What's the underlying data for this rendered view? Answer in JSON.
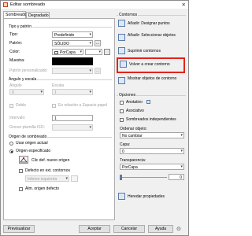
{
  "window": {
    "title": "Editar sombreado"
  },
  "tabs": [
    {
      "label": "Sombreado"
    },
    {
      "label": "Degradado"
    }
  ],
  "tipo_patron": {
    "group_title": "Tipo y patrón",
    "tipo_label": "Tipo:",
    "tipo_value": "Predefinido",
    "patron_label": "Patrón:",
    "patron_value": "SÓLIDO",
    "color_label": "Color:",
    "color_value": "PorCapa",
    "muestra_label": "Muestra:",
    "patron_personalizado_label": "Patrón personalizado:"
  },
  "angulo_escala": {
    "group_title": "Ángulo y escala",
    "angulo_label": "Ángulo",
    "angulo_value": "0",
    "escala_label": "Escala",
    "escala_value": "1",
    "doble_label": "Doble",
    "relacion_label": "En relación a Espacio papel",
    "intervalo_label": "Intervalo:",
    "intervalo_value": "1",
    "grosor_label": "Grosor plumilla ISO:"
  },
  "origen": {
    "group_title": "Origen de sombreado",
    "usar_actual_label": "Usar origen actual",
    "especificado_label": "Origen especificado",
    "clic_label": "Clic def. nuevo origen",
    "defecto_ext_label": "Defecto en ext. contornos",
    "inferior_value": "Inferior izquierda",
    "alm_label": "Alm. origen defecto"
  },
  "contornos": {
    "group_title": "Contornos",
    "anadir_designar": "Añadir: Designar puntos",
    "anadir_seleccionar": "Añadir: Seleccionar objetos",
    "suprimir": "Suprimir contornos",
    "volver_crear": "Volver a crear contorno",
    "mostrar": "Mostrar objetos de contorno"
  },
  "opciones": {
    "group_title": "Opciones",
    "anotativo": "Anotativo",
    "asociativo": "Asociativo",
    "sombreados_indep": "Sombreados independientes",
    "ordenar_label": "Ordenar objeto:",
    "ordenar_value": "No cambiar",
    "capa_label": "Capa:",
    "capa_value": "0",
    "transparencia_label": "Transparencia:",
    "transparencia_value": "PorCapa",
    "transparencia_num": "0",
    "heredar": "Heredar propiedades"
  },
  "buttons": {
    "previsualizar": "Previsualizar",
    "aceptar": "Aceptar",
    "cancelar": "Cancelar",
    "ayuda": "Ayuda"
  },
  "colors": {
    "highlight": "#e1241c"
  }
}
